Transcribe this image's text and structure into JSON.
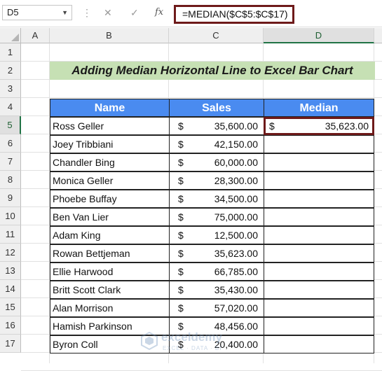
{
  "formula_bar": {
    "name_box": "D5",
    "cancel_glyph": "✕",
    "enter_glyph": "✓",
    "fx_glyph": "fx",
    "formula": "=MEDIAN($C$5:$C$17)"
  },
  "columns": [
    "A",
    "B",
    "C",
    "D"
  ],
  "rows": [
    "1",
    "2",
    "3",
    "4",
    "5",
    "6",
    "7",
    "8",
    "9",
    "10",
    "11",
    "12",
    "13",
    "14",
    "15",
    "16",
    "17"
  ],
  "title": "Adding Median Horizontal Line to Excel Bar Chart",
  "table": {
    "headers": {
      "name": "Name",
      "sales": "Sales",
      "median": "Median"
    },
    "currency": "$",
    "rows": [
      {
        "name": "Ross Geller",
        "sales": "35,600.00"
      },
      {
        "name": "Joey Tribbiani",
        "sales": "42,150.00"
      },
      {
        "name": "Chandler Bing",
        "sales": "60,000.00"
      },
      {
        "name": "Monica Geller",
        "sales": "28,300.00"
      },
      {
        "name": "Phoebe Buffay",
        "sales": "34,500.00"
      },
      {
        "name": "Ben Van Lier",
        "sales": "75,000.00"
      },
      {
        "name": "Adam King",
        "sales": "12,500.00"
      },
      {
        "name": "Rowan Bettjeman",
        "sales": "35,623.00"
      },
      {
        "name": "Ellie Harwood",
        "sales": "66,785.00"
      },
      {
        "name": "Britt Scott Clark",
        "sales": "35,430.00"
      },
      {
        "name": "Alan Morrison",
        "sales": "57,020.00"
      },
      {
        "name": "Hamish Parkinson",
        "sales": "48,456.00"
      },
      {
        "name": "Byron Coll",
        "sales": "20,400.00"
      }
    ],
    "median_value": "35,623.00"
  },
  "watermark": {
    "brand": "exceldemy",
    "tagline": "EXCEL · DATA · BI"
  },
  "colors": {
    "header_blue": "#4a8bf0",
    "title_green": "#c6e0b4",
    "highlight_border": "#6e1a1a",
    "excel_green": "#217346"
  }
}
